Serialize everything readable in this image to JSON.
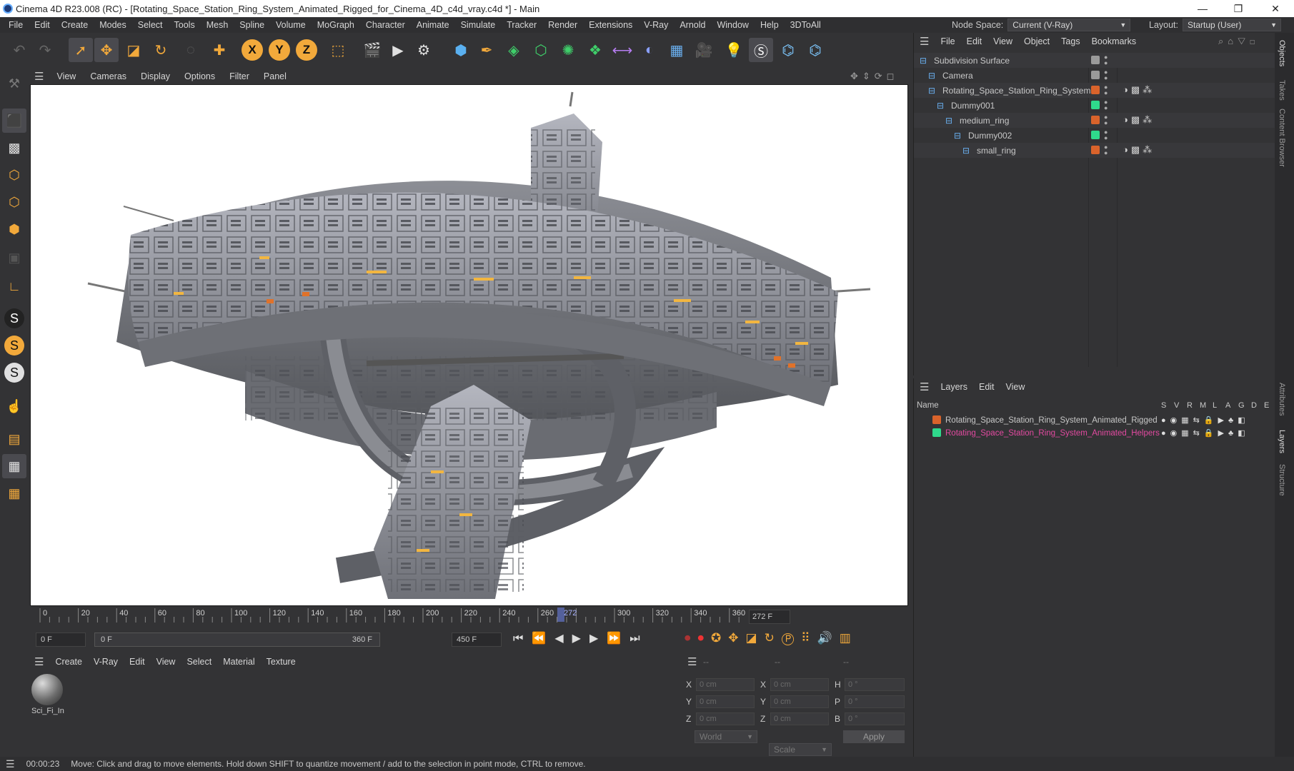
{
  "titlebar": {
    "title": "Cinema 4D R23.008 (RC) - [Rotating_Space_Station_Ring_System_Animated_Rigged_for_Cinema_4D_c4d_vray.c4d *] - Main",
    "minimize": "—",
    "maximize": "❐",
    "close": "✕"
  },
  "menubar": {
    "items": [
      "File",
      "Edit",
      "Create",
      "Modes",
      "Select",
      "Tools",
      "Mesh",
      "Spline",
      "Volume",
      "MoGraph",
      "Character",
      "Animate",
      "Simulate",
      "Tracker",
      "Render",
      "Extensions",
      "V-Ray",
      "Arnold",
      "Window",
      "Help",
      "3DToAll"
    ],
    "node_space_label": "Node Space:",
    "node_space_value": "Current (V-Ray)",
    "layout_label": "Layout:",
    "layout_value": "Startup (User)"
  },
  "viewport_menu": {
    "items": [
      "View",
      "Cameras",
      "Display",
      "Options",
      "Filter",
      "Panel"
    ]
  },
  "timeline": {
    "ticks": [
      "0",
      "20",
      "40",
      "60",
      "80",
      "100",
      "120",
      "140",
      "160",
      "180",
      "200",
      "220",
      "240",
      "260",
      "272",
      "300",
      "320",
      "340",
      "360"
    ],
    "current_label": "272",
    "current_frame_field": "272 F"
  },
  "transport": {
    "start_field": "0 F",
    "range_start": "0 F",
    "range_end": "360 F",
    "end_field": "450 F"
  },
  "material_menu": {
    "items": [
      "Create",
      "V-Ray",
      "Edit",
      "View",
      "Select",
      "Material",
      "Texture"
    ]
  },
  "material": {
    "name": "Sci_Fi_In"
  },
  "coords": {
    "header": [
      "--",
      "--",
      "--"
    ],
    "col1_labels": [
      "X",
      "Y",
      "Z"
    ],
    "col2_labels": [
      "X",
      "Y",
      "Z"
    ],
    "col3_labels": [
      "H",
      "P",
      "B"
    ],
    "col1_values": [
      "0 cm",
      "0 cm",
      "0 cm"
    ],
    "col2_values": [
      "0 cm",
      "0 cm",
      "0 cm"
    ],
    "col3_values": [
      "0 °",
      "0 °",
      "0 °"
    ],
    "world": "World",
    "scale": "Scale",
    "apply": "Apply"
  },
  "objects_menu": {
    "items": [
      "File",
      "Edit",
      "View",
      "Object",
      "Tags",
      "Bookmarks"
    ]
  },
  "objects": [
    {
      "name": "Subdivision Surface",
      "indent": 0,
      "color": "",
      "alt": true
    },
    {
      "name": "Camera",
      "indent": 1,
      "color": "",
      "alt": false
    },
    {
      "name": "Rotating_Space_Station_Ring_System",
      "indent": 1,
      "color": "#d9632b",
      "alt": true
    },
    {
      "name": "Dummy001",
      "indent": 2,
      "color": "#2fd98c",
      "alt": false
    },
    {
      "name": "medium_ring",
      "indent": 3,
      "color": "#d9632b",
      "alt": true
    },
    {
      "name": "Dummy002",
      "indent": 4,
      "color": "#2fd98c",
      "alt": false
    },
    {
      "name": "small_ring",
      "indent": 5,
      "color": "#d9632b",
      "alt": true
    }
  ],
  "layers_menu": {
    "items": [
      "Layers",
      "Edit",
      "View"
    ]
  },
  "layers_header": {
    "name": "Name",
    "flags": [
      "S",
      "V",
      "R",
      "M",
      "L",
      "A",
      "G",
      "D",
      "E"
    ]
  },
  "layers": [
    {
      "name": "Rotating_Space_Station_Ring_System_Animated_Rigged",
      "color": "#d9632b",
      "text_color": "#c8c8c8"
    },
    {
      "name": "Rotating_Space_Station_Ring_System_Animated_Helpers",
      "color": "#2fd98c",
      "text_color": "#e24aa0"
    }
  ],
  "right_tabs": [
    "Objects",
    "Takes",
    "Content Browser",
    "Attributes",
    "Layers",
    "Structure"
  ],
  "status": {
    "time": "00:00:23",
    "message": "Move: Click and drag to move elements. Hold down SHIFT to quantize movement / add to the selection in point mode, CTRL to remove."
  }
}
